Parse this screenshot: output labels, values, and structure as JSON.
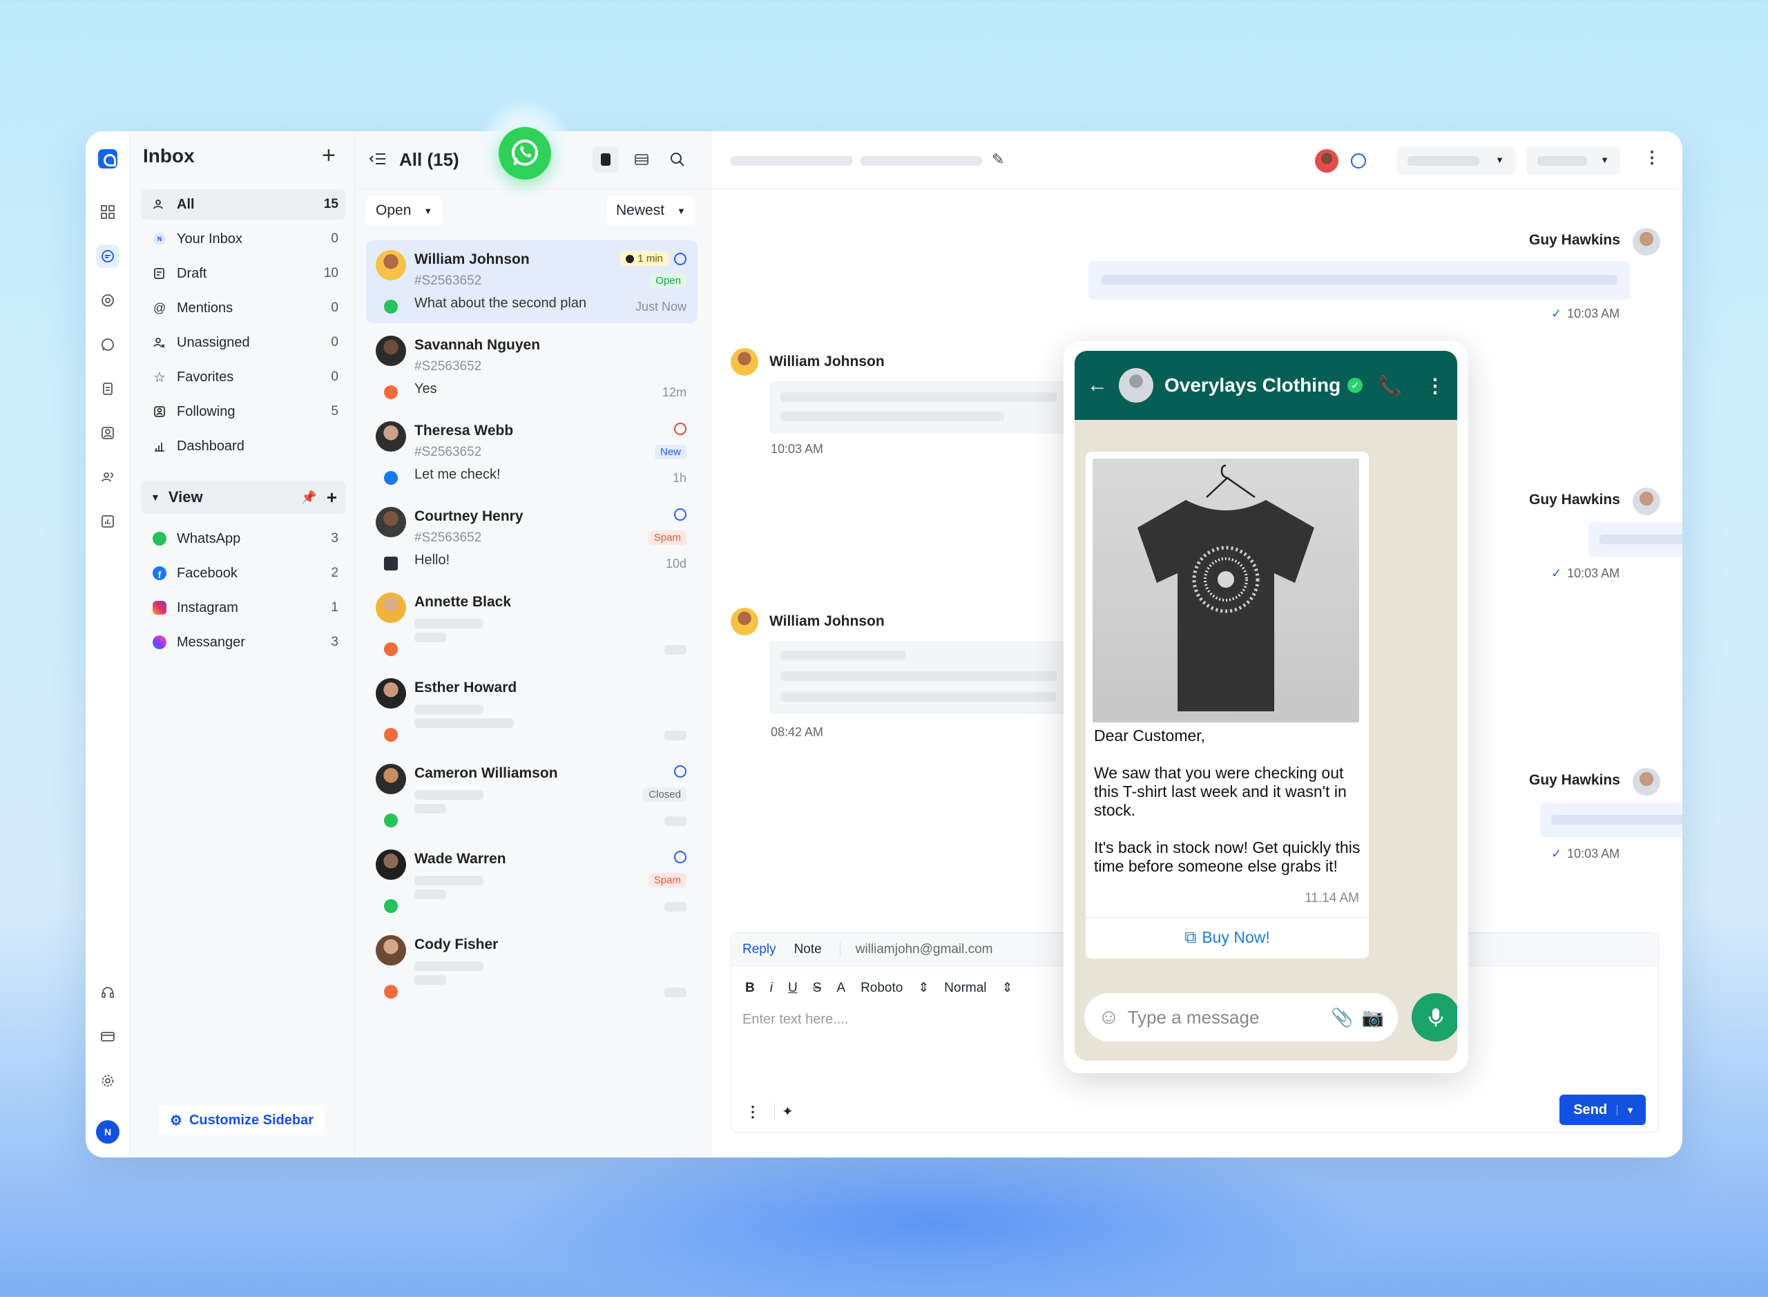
{
  "sidebar": {
    "title": "Inbox",
    "items": [
      {
        "label": "All",
        "count": "15"
      },
      {
        "label": "Your Inbox",
        "count": "0"
      },
      {
        "label": "Draft",
        "count": "10"
      },
      {
        "label": "Mentions",
        "count": "0"
      },
      {
        "label": "Unassigned",
        "count": "0"
      },
      {
        "label": "Favorites",
        "count": "0"
      },
      {
        "label": "Following",
        "count": "5"
      },
      {
        "label": "Dashboard",
        "count": ""
      }
    ],
    "view_label": "View",
    "channels": [
      {
        "label": "WhatsApp",
        "count": "3"
      },
      {
        "label": "Facebook",
        "count": "2"
      },
      {
        "label": "Instagram",
        "count": "1"
      },
      {
        "label": "Messanger",
        "count": "3"
      }
    ],
    "customize_label": "Customize Sidebar",
    "user_initial": "N"
  },
  "list": {
    "title": "All (15)",
    "status_filter": "Open",
    "sort": "Newest",
    "conversations": [
      {
        "name": "William Johnson",
        "id": "#S2563652",
        "message": "What about the second plan",
        "time": "Just Now",
        "badge": "Open",
        "tag": "1 min"
      },
      {
        "name": "Savannah Nguyen",
        "id": "#S2563652",
        "message": "Yes",
        "time": "12m"
      },
      {
        "name": "Theresa Webb",
        "id": "#S2563652",
        "message": "Let me check!",
        "time": "1h",
        "badge": "New"
      },
      {
        "name": "Courtney Henry",
        "id": "#S2563652",
        "message": "Hello!",
        "time": "10d",
        "badge": "Spam"
      },
      {
        "name": "Annette Black"
      },
      {
        "name": "Esther Howard"
      },
      {
        "name": "Cameron Williamson",
        "badge": "Closed"
      },
      {
        "name": "Wade Warren",
        "badge": "Spam"
      },
      {
        "name": "Cody Fisher"
      }
    ]
  },
  "chat": {
    "agent_name": "Guy Hawkins",
    "contact_name": "William Johnson",
    "times": [
      "10:03 AM",
      "10:03 AM",
      "10:03 AM",
      "08:42 AM",
      "10:03 AM",
      "10:03 AM"
    ]
  },
  "reply": {
    "tab_reply": "Reply",
    "tab_note": "Note",
    "email": "williamjohn@gmail.com",
    "font": "Roboto",
    "size": "Normal",
    "placeholder": "Enter text here....",
    "send_label": "Send"
  },
  "whatsapp": {
    "business_name": "Overylays Clothing",
    "greeting": "Dear Customer,",
    "para1": "We saw that you were checking out this T-shirt last week and it wasn't in stock.",
    "para2": "It's back in stock now! Get quickly this time before someone else grabs it!",
    "time": "11.14 AM",
    "button": "Buy Now!",
    "input_placeholder": "Type a message"
  },
  "colors": {
    "brand": "#1352e0",
    "whatsapp_header": "#075e54",
    "whatsapp_green": "#2fd158"
  }
}
